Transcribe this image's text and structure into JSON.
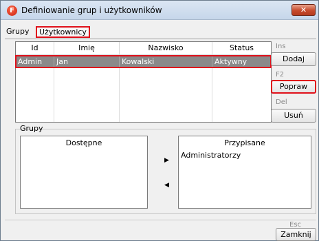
{
  "window": {
    "title": "Definiowanie grup i użytkowników",
    "app_icon_letter": "F",
    "close_glyph": "✕"
  },
  "menu": {
    "grupy": "Grupy",
    "uzytkownicy": "Użytkownicy"
  },
  "users_table": {
    "columns": [
      "Id",
      "Imię",
      "Nazwisko",
      "Status"
    ],
    "rows": [
      {
        "id": "Admin",
        "imie": "Jan",
        "nazwisko": "Kowalski",
        "status": "Aktywny"
      }
    ]
  },
  "actions": {
    "dodaj": {
      "shortcut": "Ins",
      "label": "Dodaj"
    },
    "popraw": {
      "shortcut": "F2",
      "label": "Popraw"
    },
    "usun": {
      "shortcut": "Del",
      "label": "Usuń"
    }
  },
  "groups": {
    "section_label": "Grupy",
    "available_header": "Dostępne",
    "assigned_header": "Przypisane",
    "available_items": [],
    "assigned_items": [
      "Administratorzy"
    ],
    "move_right_glyph": "▶",
    "move_left_glyph": "◀"
  },
  "footer": {
    "close_shortcut": "Esc",
    "close_label": "Zamknij"
  },
  "colors": {
    "highlight_red": "#e0101a",
    "selected_row": "#8a8a8a"
  }
}
